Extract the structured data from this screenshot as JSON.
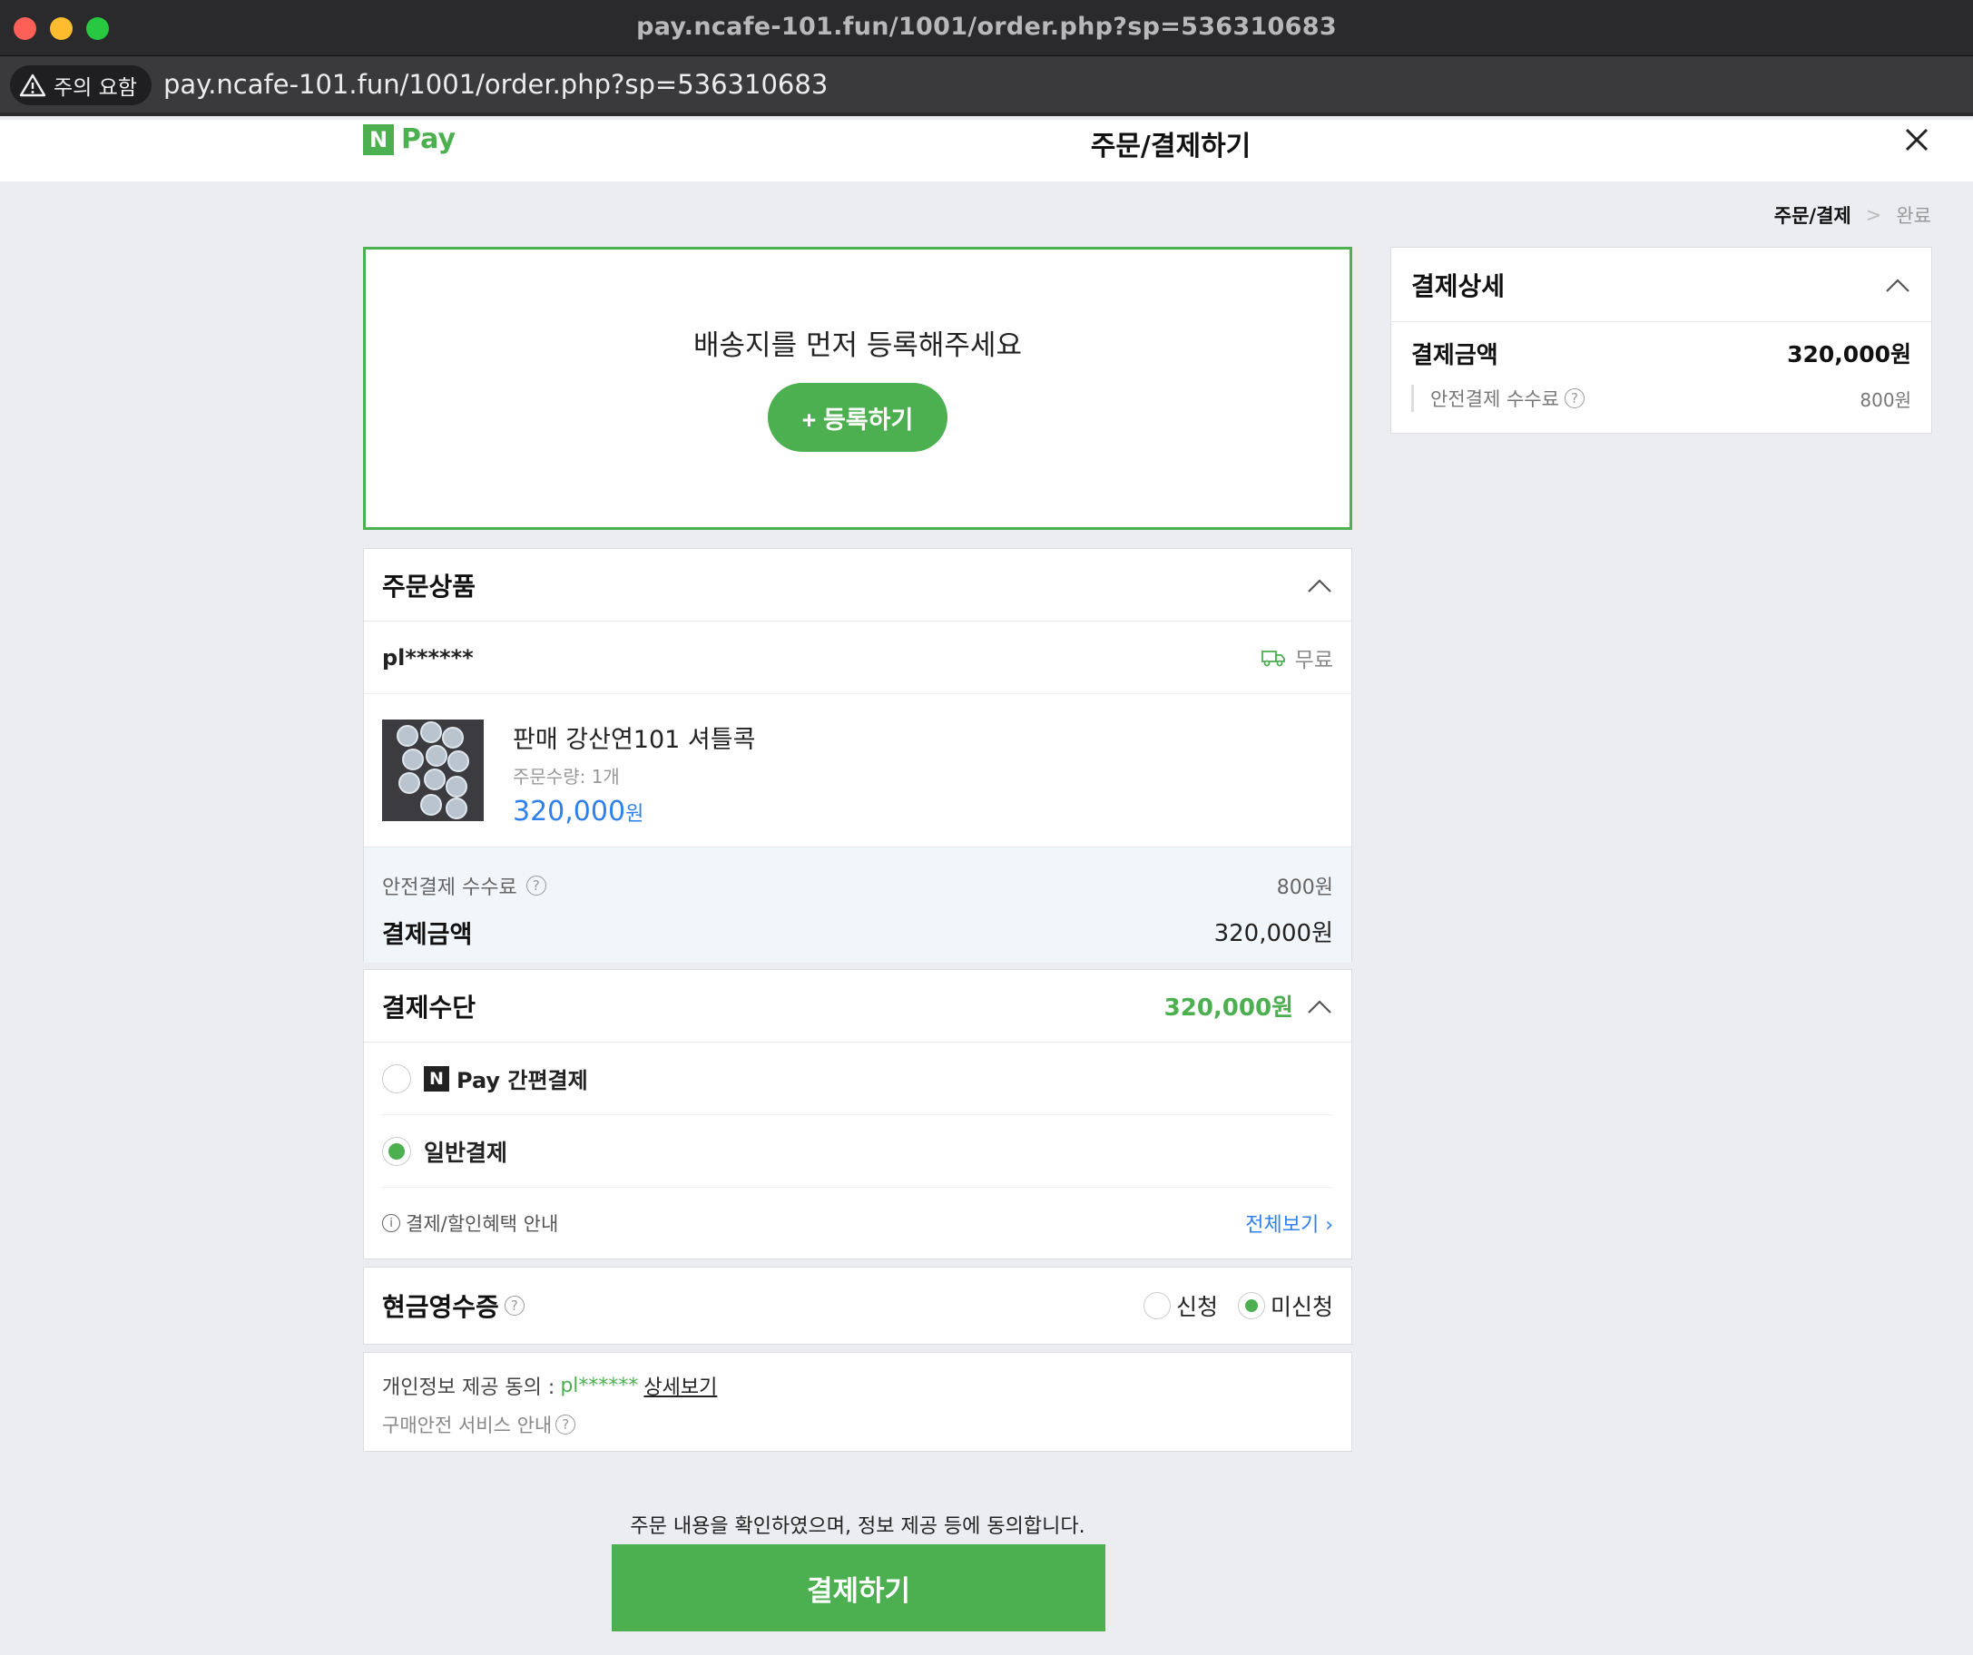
{
  "browser": {
    "title_url": "pay.ncafe-101.fun/1001/order.php?sp=536310683",
    "warning_label": "주의 요함",
    "address_url": "pay.ncafe-101.fun/1001/order.php?sp=536310683"
  },
  "header": {
    "logo_n": "N",
    "logo_pay": "Pay",
    "title": "주문/결제하기"
  },
  "steps": {
    "current": "주문/결제",
    "separator": ">",
    "next": "완료"
  },
  "address": {
    "message": "배송지를 먼저 등록해주세요",
    "register_label": "+ 등록하기"
  },
  "order": {
    "title": "주문상품",
    "seller": "pl******",
    "shipping": "무료",
    "product_name": "판매 강산연101 셔틀콕",
    "quantity": "주문수량: 1개",
    "price": "320,000",
    "price_unit": "원",
    "fee_label": "안전결제 수수료",
    "fee_value": "800원",
    "total_label": "결제금액",
    "total_value": "320,000원"
  },
  "method": {
    "title": "결제수단",
    "amount": "320,000원",
    "npay_n": "N",
    "npay_label": "Pay 간편결제",
    "general_label": "일반결제",
    "benefit_label": "결제/할인혜택 안내",
    "view_all": "전체보기 ›"
  },
  "receipt": {
    "title": "현금영수증",
    "apply": "신청",
    "not_apply": "미신청"
  },
  "consent": {
    "prefix": "개인정보 제공 동의 :",
    "seller": "pl******",
    "detail": "상세보기",
    "safety": "구매안전 서비스 안내"
  },
  "footer": {
    "agree_text": "주문 내용을 확인하였으며, 정보 제공 등에 동의합니다.",
    "pay_label": "결제하기"
  },
  "summary": {
    "title": "결제상세",
    "amount_label": "결제금액",
    "amount_value": "320,000원",
    "fee_label": "안전결제 수수료",
    "fee_value": "800원"
  },
  "colors": {
    "accent": "#4caf50",
    "price_blue": "#2f80ed"
  },
  "icons": [
    "warning-icon",
    "close-icon",
    "chevron-up-icon",
    "truck-icon",
    "question-icon",
    "info-icon"
  ]
}
